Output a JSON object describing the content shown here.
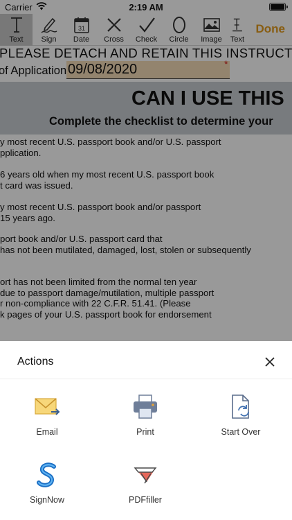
{
  "status_bar": {
    "carrier": "Carrier",
    "time": "2:19 AM"
  },
  "toolbar": {
    "tools": [
      {
        "label": "Text",
        "icon": "text-cursor-icon",
        "active": true
      },
      {
        "label": "Sign",
        "icon": "signature-pen-icon"
      },
      {
        "label": "Date",
        "icon": "calendar-icon",
        "calendar_day": "31"
      },
      {
        "label": "Cross",
        "icon": "cross-icon"
      },
      {
        "label": "Check",
        "icon": "checkmark-icon"
      },
      {
        "label": "Circle",
        "icon": "circle-icon"
      },
      {
        "label": "Image",
        "icon": "image-icon"
      },
      {
        "label": "Text",
        "icon": "text-stamp-icon"
      }
    ],
    "done_label": "Done",
    "done_color": "#e39b1e"
  },
  "document": {
    "detach_line": "PLEASE DETACH AND RETAIN THIS INSTRUCT",
    "application_label": "of Application:",
    "application_date": "09/08/2020",
    "required_marker": "*",
    "heading": "CAN I USE THIS",
    "subheading": "Complete the checklist to determine your",
    "body_lines": [
      "y most recent U.S. passport book and/or U.S. passport",
      "pplication.",
      "6 years old when my most recent U.S. passport book",
      "t card was issued.",
      "y most recent U.S. passport book and/or passport",
      "15 years ago.",
      "port book and/or U.S. passport card that",
      "has not been mutilated, damaged, lost, stolen or subsequently",
      "ort has not been limited from the normal ten year",
      "due to passport damage/mutilation, multiple passport",
      "r non-compliance with 22 C.F.R. 51.41.  (Please",
      "k pages of your U.S. passport book for endorsement"
    ]
  },
  "actions_sheet": {
    "title": "Actions",
    "items": [
      {
        "label": "Email",
        "icon": "email-icon"
      },
      {
        "label": "Print",
        "icon": "printer-icon"
      },
      {
        "label": "Start Over",
        "icon": "start-over-icon"
      },
      {
        "label": "SignNow",
        "icon": "signnow-icon"
      },
      {
        "label": "PDFfiller",
        "icon": "pdffiller-icon"
      }
    ]
  }
}
